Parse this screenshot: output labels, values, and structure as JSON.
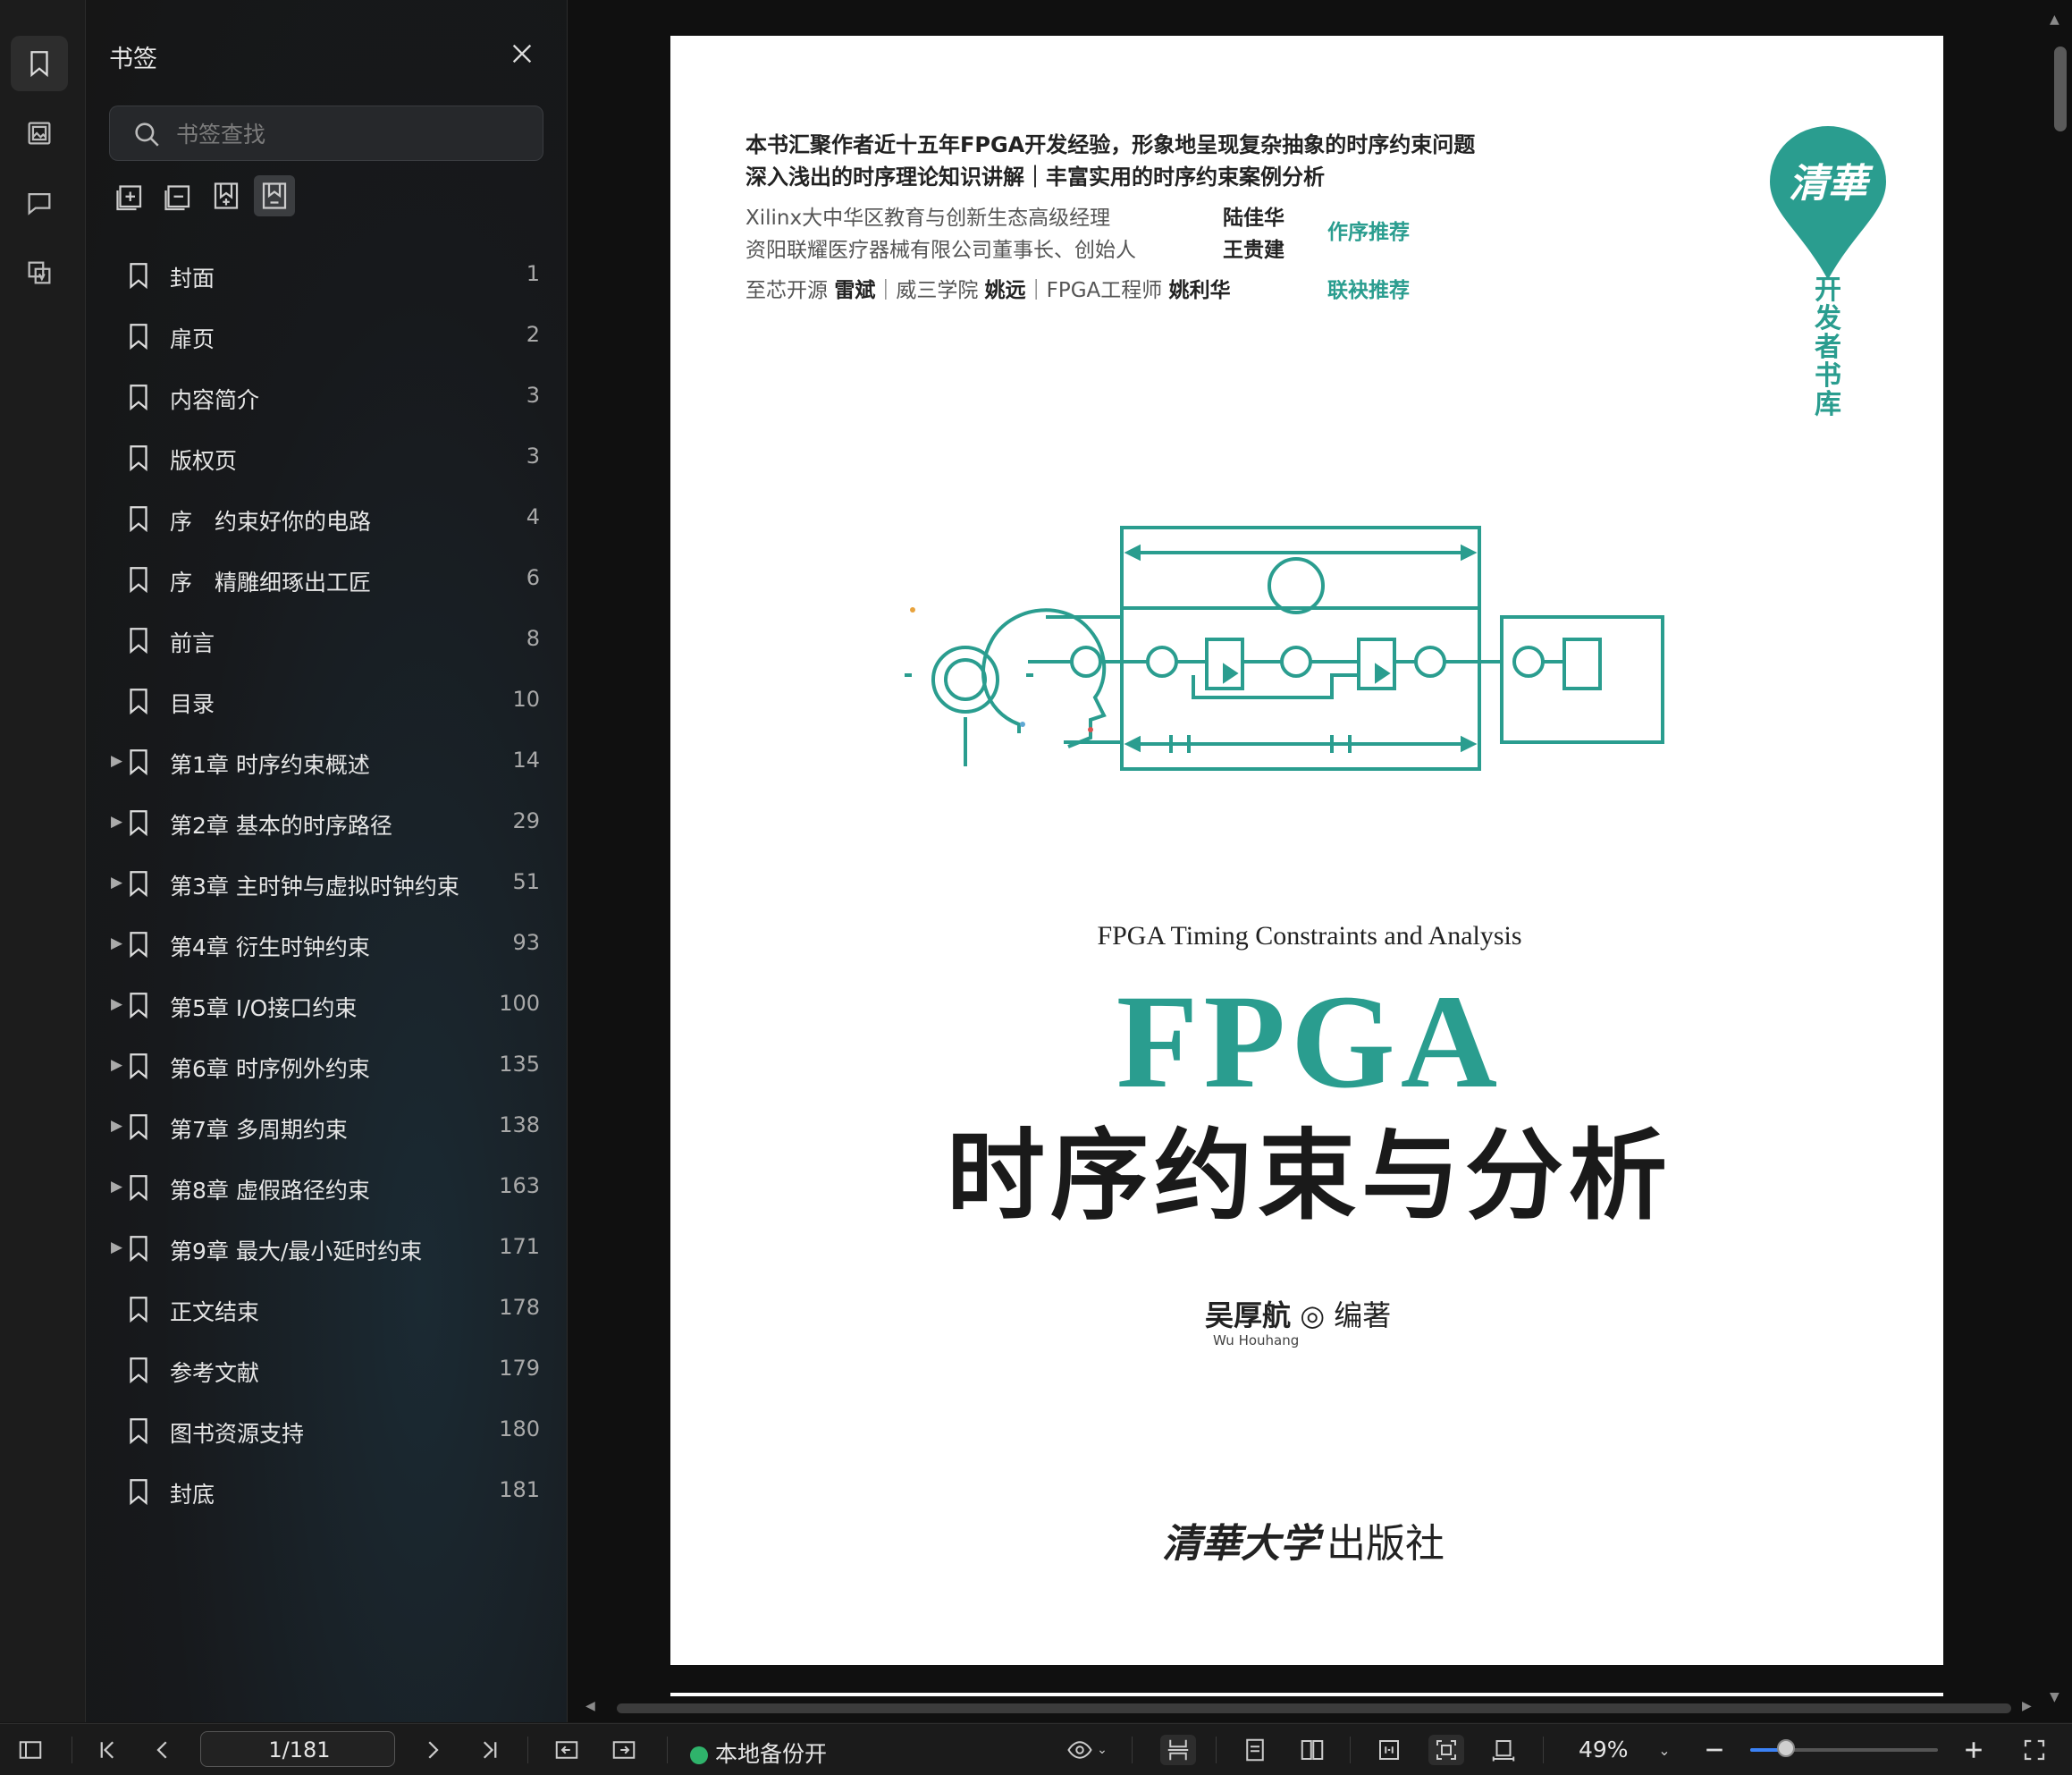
{
  "sidebar_panel": {
    "title": "书签",
    "search_placeholder": "书签查找",
    "bookmarks": [
      {
        "label": "封面",
        "page": "1",
        "expandable": false
      },
      {
        "label": "扉页",
        "page": "2",
        "expandable": false
      },
      {
        "label": "内容简介",
        "page": "3",
        "expandable": false
      },
      {
        "label": "版权页",
        "page": "3",
        "expandable": false
      },
      {
        "label": "序　约束好你的电路",
        "page": "4",
        "expandable": false
      },
      {
        "label": "序　精雕细琢出工匠",
        "page": "6",
        "expandable": false
      },
      {
        "label": "前言",
        "page": "8",
        "expandable": false
      },
      {
        "label": "目录",
        "page": "10",
        "expandable": false
      },
      {
        "label": "第1章 时序约束概述",
        "page": "14",
        "expandable": true
      },
      {
        "label": "第2章 基本的时序路径",
        "page": "29",
        "expandable": true
      },
      {
        "label": "第3章 主时钟与虚拟时钟约束",
        "page": "51",
        "expandable": true
      },
      {
        "label": "第4章 衍生时钟约束",
        "page": "93",
        "expandable": true
      },
      {
        "label": "第5章 I/O接口约束",
        "page": "100",
        "expandable": true
      },
      {
        "label": "第6章 时序例外约束",
        "page": "135",
        "expandable": true
      },
      {
        "label": "第7章 多周期约束",
        "page": "138",
        "expandable": true
      },
      {
        "label": "第8章 虚假路径约束",
        "page": "163",
        "expandable": true
      },
      {
        "label": "第9章 最大/最小延时约束",
        "page": "171",
        "expandable": true
      },
      {
        "label": "正文结束",
        "page": "178",
        "expandable": false
      },
      {
        "label": "参考文献",
        "page": "179",
        "expandable": false
      },
      {
        "label": "图书资源支持",
        "page": "180",
        "expandable": false
      },
      {
        "label": "封底",
        "page": "181",
        "expandable": false
      }
    ]
  },
  "cover": {
    "blurb_line1": "本书汇聚作者近十五年FPGA开发经验，形象地呈现复杂抽象的时序约束问题",
    "blurb_line2": "深入浅出的时序理论知识讲解｜丰富实用的时序约束案例分析",
    "rec1_title": "Xilinx大中华区教育与创新生态高级经理",
    "rec1_name": "陆佳华",
    "rec2_title": "资阳联耀医疗器械有限公司董事长、创始人",
    "rec2_name": "王贵建",
    "rec_tag1": "作序推荐",
    "rec3_prefix": "至芯开源 ",
    "rec3_name1": "雷斌",
    "rec3_mid1": "｜威三学院 ",
    "rec3_name2": "姚远",
    "rec3_mid2": "｜FPGA工程师 ",
    "rec3_name3": "姚利华",
    "rec_tag2": "联袂推荐",
    "series_logo": "清華",
    "series_name": [
      "开",
      "发",
      "者",
      "书",
      "库"
    ],
    "subtitle_en": "FPGA Timing Constraints and Analysis",
    "title_big": "FPGA",
    "title_zh": "时序约束与分析",
    "author_name": "吴厚航",
    "author_role": "编著",
    "author_en": "Wu Houhang",
    "publisher_logo": "清華大学",
    "publisher_suffix": "出版社"
  },
  "statusbar": {
    "page_value": "1/181",
    "backup_label": "本地备份开",
    "zoom": "49%",
    "zoom_slider_fraction": 0.19
  },
  "colors": {
    "accent_teal": "#2a9d8f",
    "backup_green": "#2fb36b",
    "slider_blue": "#3b82f6"
  }
}
